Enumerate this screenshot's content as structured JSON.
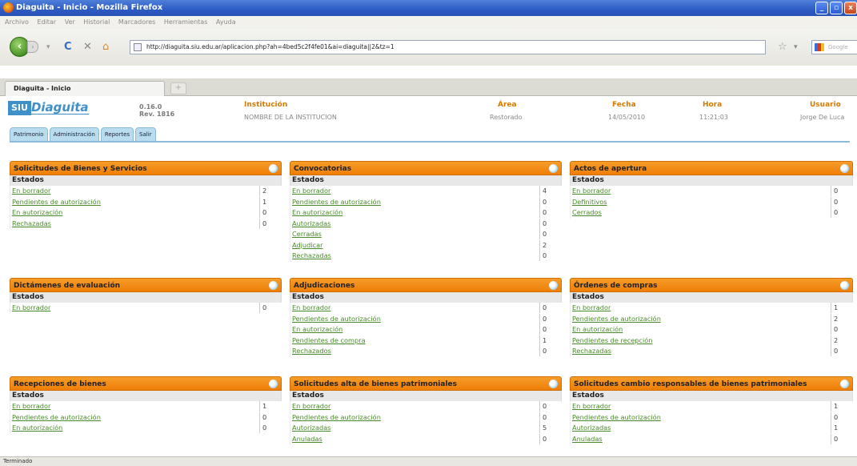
{
  "window": {
    "title": "Diaguita - Inicio - Mozilla Firefox"
  },
  "menubar": [
    "Archivo",
    "Editar",
    "Ver",
    "Historial",
    "Marcadores",
    "Herramientas",
    "Ayuda"
  ],
  "url": "http://diaguita.siu.edu.ar/aplicacion.php?ah=4bed5c2f4fe01&ai=diaguita||2&tz=1",
  "search": {
    "placeholder": "Google"
  },
  "tab": {
    "label": "Diaguita - Inicio"
  },
  "app": {
    "logo_siu": "SIU",
    "logo_name": "Diaguita",
    "version": "0.16.0",
    "revision": "Rev. 1816",
    "institucion_label": "Institución",
    "institucion_value": "NOMBRE DE LA INSTITUCION",
    "area_label": "Área",
    "area_value": "Restorado",
    "fecha_label": "Fecha",
    "fecha_value": "14/05/2010",
    "hora_label": "Hora",
    "hora_value": "11:21:03",
    "usuario_label": "Usuario",
    "usuario_value": "Jorge De Luca"
  },
  "menu": [
    "Patrimonio",
    "Administración",
    "Reportes",
    "Salir"
  ],
  "estados_label": "Estados",
  "panels": [
    {
      "title": "Solicitudes de Bienes y Servicios",
      "rows": [
        [
          "En borrador",
          "2"
        ],
        [
          "Pendientes de autorización",
          "1"
        ],
        [
          "En autorización",
          "0"
        ],
        [
          "Rechazadas",
          "0"
        ]
      ]
    },
    {
      "title": "Convocatorias",
      "rows": [
        [
          "En borrador",
          "4"
        ],
        [
          "Pendientes de autorización",
          "0"
        ],
        [
          "En autorización",
          "0"
        ],
        [
          "Autorizadas",
          "0"
        ],
        [
          "Cerradas",
          "0"
        ],
        [
          "Adjudicar",
          "2"
        ],
        [
          "Rechazadas",
          "0"
        ]
      ]
    },
    {
      "title": "Actos de apertura",
      "rows": [
        [
          "En borrador",
          "0"
        ],
        [
          "Definitivos",
          "0"
        ],
        [
          "Cerrados",
          "0"
        ]
      ]
    },
    {
      "title": "Dictámenes de evaluación",
      "rows": [
        [
          "En borrador",
          "0"
        ]
      ]
    },
    {
      "title": "Adjudicaciones",
      "rows": [
        [
          "En borrador",
          "0"
        ],
        [
          "Pendientes de autorización",
          "0"
        ],
        [
          "En autorización",
          "0"
        ],
        [
          "Pendientes de compra",
          "1"
        ],
        [
          "Rechazados",
          "0"
        ]
      ]
    },
    {
      "title": "Órdenes de compras",
      "rows": [
        [
          "En borrador",
          "1"
        ],
        [
          "Pendientes de autorización",
          "2"
        ],
        [
          "En autorización",
          "0"
        ],
        [
          "Pendientes de recepción",
          "2"
        ],
        [
          "Rechazadas",
          "0"
        ]
      ]
    },
    {
      "title": "Recepciones de bienes",
      "rows": [
        [
          "En borrador",
          "1"
        ],
        [
          "Pendientes de autorización",
          "0"
        ],
        [
          "En autorización",
          "0"
        ]
      ]
    },
    {
      "title": "Solicitudes alta de bienes patrimoniales",
      "rows": [
        [
          "En borrador",
          "0"
        ],
        [
          "Pendientes de autorización",
          "0"
        ],
        [
          "Autorizadas",
          "5"
        ],
        [
          "Anuladas",
          "0"
        ]
      ]
    },
    {
      "title": "Solicitudes cambio responsables de bienes patrimoniales",
      "rows": [
        [
          "En borrador",
          "1"
        ],
        [
          "Pendientes de autorización",
          "0"
        ],
        [
          "Autorizadas",
          "1"
        ],
        [
          "Anuladas",
          "0"
        ]
      ]
    }
  ],
  "status": "Terminado"
}
